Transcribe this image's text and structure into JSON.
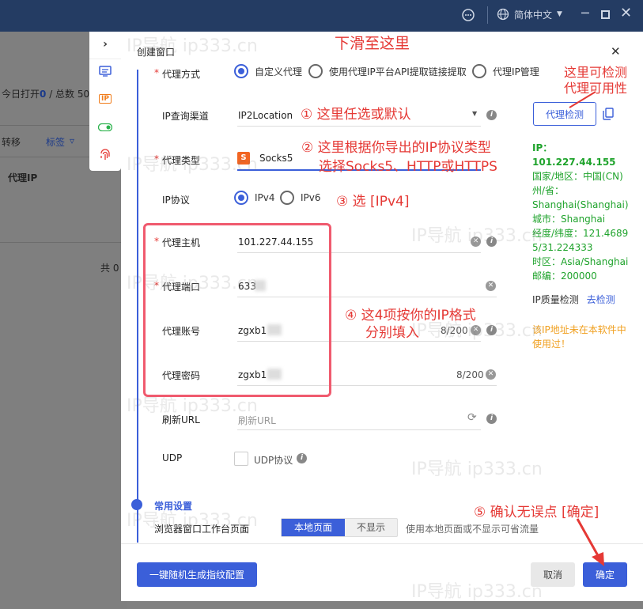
{
  "topbar": {
    "lang": "简体中文"
  },
  "background": {
    "today_open_label": "今日打开",
    "today_open_value": "0",
    "total_label": "/ 总数 50",
    "transfer": "转移",
    "tag": "标签",
    "proxy_ip_col": "代理IP",
    "total_count": "共 0"
  },
  "sidebar_mini": {
    "ip_badge": "IP"
  },
  "dialog": {
    "title": "创建窗口"
  },
  "proxy_method": {
    "label": "代理方式",
    "options": [
      "自定义代理",
      "使用代理IP平台API提取链接提取",
      "代理IP管理"
    ]
  },
  "ip_query": {
    "label": "IP查询渠道",
    "value": "IP2Location",
    "check_button": "代理检测"
  },
  "proxy_type": {
    "label": "代理类型",
    "value": "Socks5",
    "badge": "S"
  },
  "ip_protocol": {
    "label": "IP协议",
    "options": [
      "IPv4",
      "IPv6"
    ]
  },
  "proxy_host": {
    "label": "代理主机",
    "value": "101.227.44.155"
  },
  "proxy_port": {
    "label": "代理端口",
    "value": "633"
  },
  "proxy_account": {
    "label": "代理账号",
    "value": "zgxb1",
    "counter": "8/200"
  },
  "proxy_password": {
    "label": "代理密码",
    "value": "zgxb1",
    "counter": "8/200"
  },
  "refresh_url": {
    "label": "刷新URL",
    "placeholder": "刷新URL"
  },
  "udp": {
    "label": "UDP",
    "checkbox_label": "UDP协议"
  },
  "common": {
    "section": "常用设置",
    "workbench_label": "浏览器窗口工作台页面",
    "seg_on": "本地页面",
    "seg_off": "不显示",
    "hint": "使用本地页面或不显示可省流量"
  },
  "ip_info": {
    "ip": "IP：101.227.44.155",
    "country": "国家/地区：中国(CN)",
    "province": "州/省：Shanghai(Shanghai)",
    "city": "城市：Shanghai",
    "lonlat": "经度/纬度：121.46895/31.224333",
    "timezone": "时区：Asia/Shanghai",
    "zip": "邮编：200000"
  },
  "quality": {
    "label": "IP质量检测",
    "link": "去检测"
  },
  "warning": "该IP地址未在本软件中使用过！",
  "footer": {
    "gen_button": "一键随机生成指纹配置",
    "cancel": "取消",
    "confirm": "确定"
  },
  "annotations": {
    "scroll": "下滑至这里",
    "check": "这里可检测代理可用性",
    "a1": "① 这里任选或默认",
    "a2a": "② 这里根据你导出的IP协议类型",
    "a2b": "选择Socks5、HTTP或HTTPS",
    "a3": "③ 选 [IPv4]",
    "a4a": "④ 这4项按你的IP格式",
    "a4b": "分别填入",
    "a5": "⑤ 确认无误点 [确定]",
    "watermark": "IP导航 ip333.cn"
  },
  "colors": {
    "primary": "#3b5fd9",
    "annotation": "#e53935",
    "green": "#1fa32c",
    "warning": "#f0a020"
  }
}
